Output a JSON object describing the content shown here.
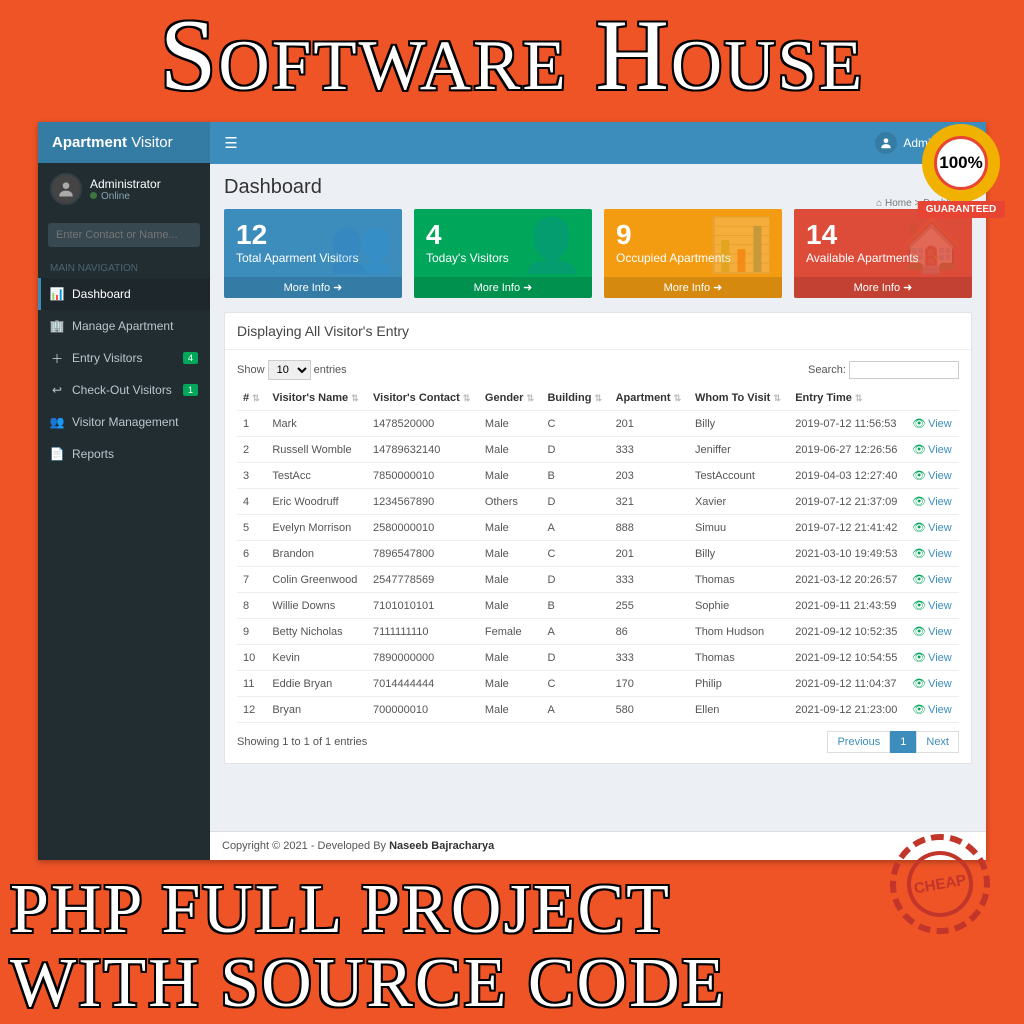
{
  "promo": {
    "top": "Software House",
    "bottom_line1": "PHP FULL PROJECT",
    "bottom_line2": "WITH SOURCE CODE",
    "cheap_stamp": "CHEAP",
    "badge_value": "100%",
    "badge_ribbon": "GUARANTEED"
  },
  "brand": {
    "bold": "Apartment",
    "light": "Visitor"
  },
  "user": {
    "name": "Administrator",
    "status": "Online"
  },
  "search": {
    "placeholder": "Enter Contact or Name..."
  },
  "nav": {
    "header": "MAIN NAVIGATION",
    "items": [
      {
        "label": "Dashboard",
        "active": true
      },
      {
        "label": "Manage Apartment"
      },
      {
        "label": "Entry Visitors",
        "badge": "4"
      },
      {
        "label": "Check-Out Visitors",
        "badge": "1"
      },
      {
        "label": "Visitor Management"
      },
      {
        "label": "Reports"
      }
    ]
  },
  "topbar": {
    "user_label": "Administrator"
  },
  "page": {
    "title": "Dashboard",
    "breadcrumb_home": "Home",
    "breadcrumb_page": "Dashboard"
  },
  "stats": [
    {
      "value": "12",
      "label": "Total Aparment Visitors",
      "more": "More Info ➜"
    },
    {
      "value": "4",
      "label": "Today's Visitors",
      "more": "More Info ➜"
    },
    {
      "value": "9",
      "label": "Occupied Apartments",
      "more": "More Info ➜"
    },
    {
      "value": "14",
      "label": "Available Apartments",
      "more": "More Info ➜"
    }
  ],
  "table": {
    "title": "Displaying All Visitor's Entry",
    "show_label_pre": "Show",
    "show_value": "10",
    "show_label_post": "entries",
    "search_label": "Search:",
    "columns": [
      "#",
      "Visitor's Name",
      "Visitor's Contact",
      "Gender",
      "Building",
      "Apartment",
      "Whom To Visit",
      "Entry Time",
      ""
    ],
    "view_label": "View",
    "rows": [
      [
        "1",
        "Mark",
        "1478520000",
        "Male",
        "C",
        "201",
        "Billy",
        "2019-07-12 11:56:53"
      ],
      [
        "2",
        "Russell Womble",
        "14789632140",
        "Male",
        "D",
        "333",
        "Jeniffer",
        "2019-06-27 12:26:56"
      ],
      [
        "3",
        "TestAcc",
        "7850000010",
        "Male",
        "B",
        "203",
        "TestAccount",
        "2019-04-03 12:27:40"
      ],
      [
        "4",
        "Eric Woodruff",
        "1234567890",
        "Others",
        "D",
        "321",
        "Xavier",
        "2019-07-12 21:37:09"
      ],
      [
        "5",
        "Evelyn Morrison",
        "2580000010",
        "Male",
        "A",
        "888",
        "Simuu",
        "2019-07-12 21:41:42"
      ],
      [
        "6",
        "Brandon",
        "7896547800",
        "Male",
        "C",
        "201",
        "Billy",
        "2021-03-10 19:49:53"
      ],
      [
        "7",
        "Colin Greenwood",
        "2547778569",
        "Male",
        "D",
        "333",
        "Thomas",
        "2021-03-12 20:26:57"
      ],
      [
        "8",
        "Willie Downs",
        "7101010101",
        "Male",
        "B",
        "255",
        "Sophie",
        "2021-09-11 21:43:59"
      ],
      [
        "9",
        "Betty Nicholas",
        "7111111110",
        "Female",
        "A",
        "86",
        "Thom Hudson",
        "2021-09-12 10:52:35"
      ],
      [
        "10",
        "Kevin",
        "7890000000",
        "Male",
        "D",
        "333",
        "Thomas",
        "2021-09-12 10:54:55"
      ],
      [
        "11",
        "Eddie Bryan",
        "7014444444",
        "Male",
        "C",
        "170",
        "Philip",
        "2021-09-12 11:04:37"
      ],
      [
        "12",
        "Bryan",
        "700000010",
        "Male",
        "A",
        "580",
        "Ellen",
        "2021-09-12 21:23:00"
      ]
    ],
    "info": "Showing 1 to 1 of 1 entries",
    "pager": {
      "prev": "Previous",
      "page": "1",
      "next": "Next"
    }
  },
  "footer": {
    "copyright": "Copyright © 2021 - Developed By ",
    "author": "Naseeb Bajracharya"
  }
}
